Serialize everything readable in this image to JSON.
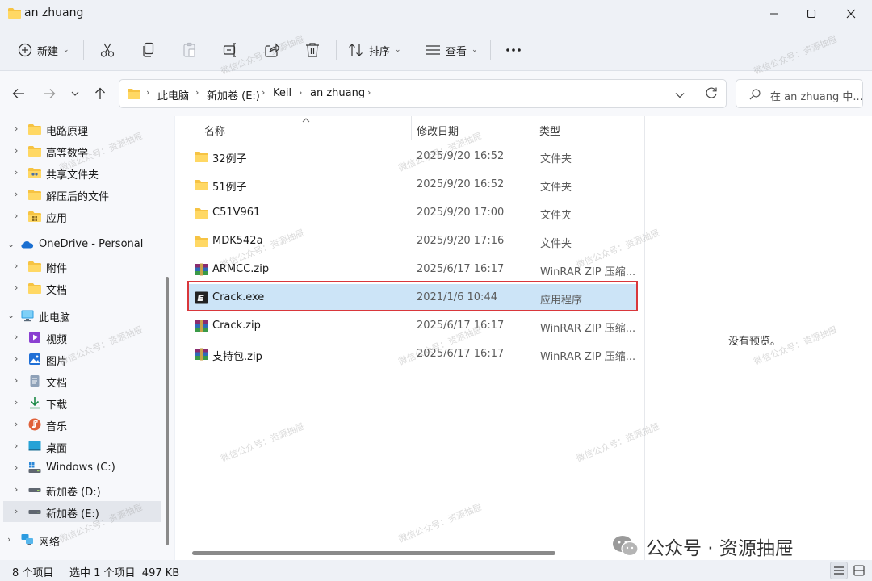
{
  "window": {
    "title": "an zhuang",
    "controls": [
      "minimize-icon",
      "maximize-icon",
      "close-icon"
    ]
  },
  "toolbar": {
    "new_label": "新建",
    "sort_label": "排序",
    "view_label": "查看",
    "icons": [
      "cut-icon",
      "copy-icon",
      "paste-icon",
      "rename-icon",
      "share-icon",
      "delete-icon",
      "more-icon"
    ]
  },
  "navigation": {
    "breadcrumb": [
      "此电脑",
      "新加卷 (E:)",
      "Keil",
      "an zhuang"
    ],
    "search_placeholder": "在 an zhuang 中..."
  },
  "sidebar": {
    "items": [
      {
        "label": "电路原理",
        "icon": "folder-icon"
      },
      {
        "label": "高等数学",
        "icon": "folder-icon"
      },
      {
        "label": "共享文件夹",
        "icon": "shared-folder-icon"
      },
      {
        "label": "解压后的文件",
        "icon": "folder-icon"
      },
      {
        "label": "应用",
        "icon": "apps-folder-icon"
      },
      {
        "label": "OneDrive - Personal",
        "icon": "onedrive-icon"
      },
      {
        "label": "附件",
        "icon": "folder-icon"
      },
      {
        "label": "文档",
        "icon": "folder-icon"
      },
      {
        "label": "此电脑",
        "icon": "computer-icon"
      },
      {
        "label": "视频",
        "icon": "videos-icon"
      },
      {
        "label": "图片",
        "icon": "pictures-icon"
      },
      {
        "label": "文档",
        "icon": "documents-icon"
      },
      {
        "label": "下载",
        "icon": "downloads-icon"
      },
      {
        "label": "音乐",
        "icon": "music-icon"
      },
      {
        "label": "桌面",
        "icon": "desktop-icon"
      },
      {
        "label": "Windows (C:)",
        "icon": "windows-drive-icon"
      },
      {
        "label": "新加卷 (D:)",
        "icon": "drive-icon"
      },
      {
        "label": "新加卷 (E:)",
        "icon": "drive-icon"
      },
      {
        "label": "网络",
        "icon": "network-icon"
      }
    ]
  },
  "file_list": {
    "columns": [
      "名称",
      "修改日期",
      "类型"
    ],
    "rows": [
      {
        "name": "32例子",
        "date": "2025/9/20 16:52",
        "type": "文件夹",
        "icon": "folder-icon"
      },
      {
        "name": "51例子",
        "date": "2025/9/20 16:52",
        "type": "文件夹",
        "icon": "folder-icon"
      },
      {
        "name": "C51V961",
        "date": "2025/9/20 17:00",
        "type": "文件夹",
        "icon": "folder-icon"
      },
      {
        "name": "MDK542a",
        "date": "2025/9/20 17:16",
        "type": "文件夹",
        "icon": "folder-icon"
      },
      {
        "name": "ARMCC.zip",
        "date": "2025/6/17 16:17",
        "type": "WinRAR ZIP 压缩...",
        "icon": "winrar-icon"
      },
      {
        "name": "Crack.exe",
        "date": "2021/1/6 10:44",
        "type": "应用程序",
        "icon": "exe-icon"
      },
      {
        "name": "Crack.zip",
        "date": "2025/6/17 16:17",
        "type": "WinRAR ZIP 压缩...",
        "icon": "winrar-icon"
      },
      {
        "name": "支持包.zip",
        "date": "2025/6/17 16:17",
        "type": "WinRAR ZIP 压缩...",
        "icon": "winrar-icon"
      }
    ],
    "selected_row": "Crack.exe"
  },
  "preview": {
    "empty_text": "没有预览。"
  },
  "status": {
    "item_count": "8 个项目",
    "selection": "选中 1 个项目  497 KB"
  },
  "watermark": {
    "text": "微信公众号：资源抽屉",
    "brand": "公众号 · 资源抽屉"
  }
}
